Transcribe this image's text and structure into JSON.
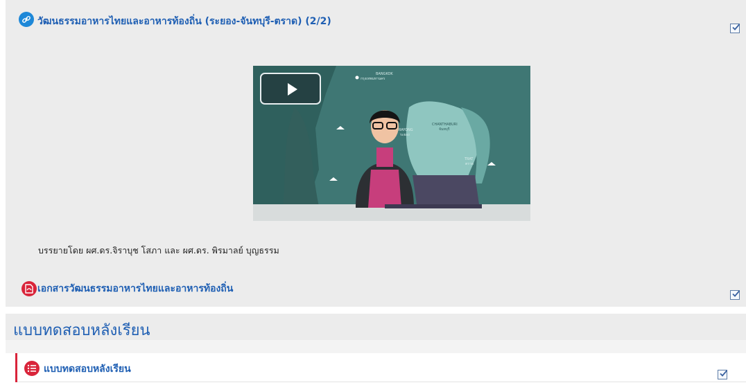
{
  "video_activity": {
    "title": "วัฒนธรรมอาหารไทยและอาหารท้องถิ่น (ระยอง-จันทบุรี-ตราด) (2/2)",
    "icon": "link-icon",
    "completed": true,
    "caption": "บรรยายโดย ผศ.ดร.จิราบุช โสภา และ ผศ.ดร. พิรมาลย์ บุญธรรม",
    "map_labels": {
      "top": "BANGKOK",
      "top_thai": "กรุงเทพมหานคร",
      "mid": "CHANTHABURI",
      "mid_thai": "จันทบุรี",
      "left": "RAYONG",
      "left_thai": "ระยอง",
      "bottom": "TRAT",
      "bottom_thai": "ตราด"
    }
  },
  "document_activity": {
    "title": "เอกสารวัฒนธรรมอาหารไทยและอาหารท้องถิ่น",
    "icon": "pdf-icon",
    "completed": true
  },
  "section": {
    "title": "แบบทดสอบหลังเรียน"
  },
  "quiz_activity": {
    "title": "แบบทดสอบหลังเรียน",
    "icon": "quiz-icon",
    "completed": true
  },
  "colors": {
    "link": "#1f5fb3",
    "panel": "#ececec",
    "accent_red": "#d9243a",
    "video_bg": "#3f7774"
  }
}
